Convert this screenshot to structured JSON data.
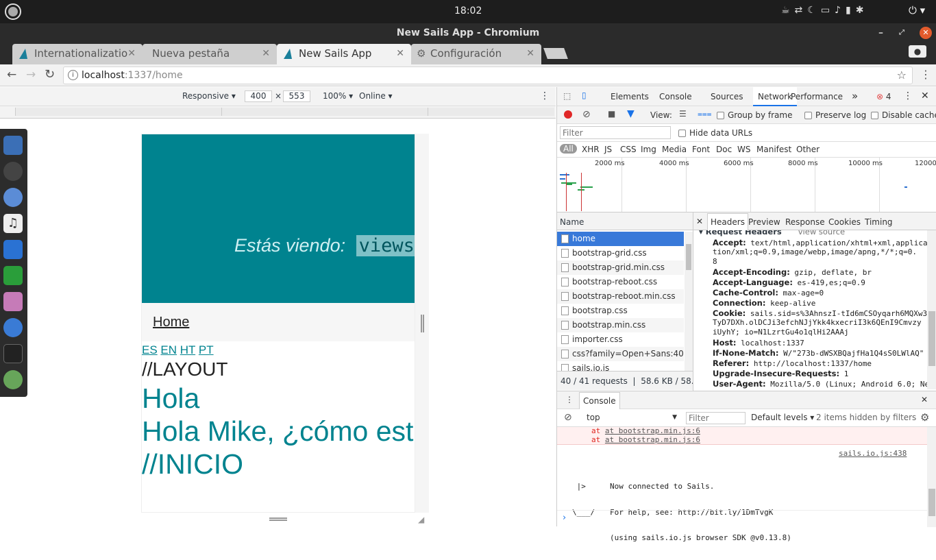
{
  "os": {
    "time": "18:02"
  },
  "window": {
    "title": "New Sails App - Chromium"
  },
  "tabs": [
    {
      "label": "Internationalizatio"
    },
    {
      "label": "Nueva pestaña"
    },
    {
      "label": "New Sails App"
    },
    {
      "label": "Configuración"
    }
  ],
  "address": {
    "host": "localhost",
    "rest": ":1337/home"
  },
  "device_toolbar": {
    "mode": "Responsive",
    "width": "400",
    "height": "553",
    "zoom": "100%",
    "network": "Online"
  },
  "page": {
    "hero_text": "Estás viendo:",
    "hero_code": "views/",
    "nav_home": "Home",
    "langs": [
      "ES",
      "EN",
      "HT",
      "PT"
    ],
    "layout": "//LAYOUT",
    "hola": "Hola",
    "greeting": "Hola Mike, ¿cómo estás?",
    "inicio": "//INICIO"
  },
  "devtools": {
    "tabs": [
      "Elements",
      "Console",
      "Sources",
      "Network",
      "Performance"
    ],
    "error_count": "4",
    "view_label": "View:",
    "group_by_frame": "Group by frame",
    "preserve_log": "Preserve log",
    "disable_cache": "Disable cache",
    "filter_placeholder": "Filter",
    "hide_data_urls": "Hide data URLs",
    "types": [
      "All",
      "XHR",
      "JS",
      "CSS",
      "Img",
      "Media",
      "Font",
      "Doc",
      "WS",
      "Manifest",
      "Other"
    ],
    "timeline_ticks": [
      "2000 ms",
      "4000 ms",
      "6000 ms",
      "8000 ms",
      "10000 ms",
      "12000"
    ],
    "name_header": "Name",
    "files": [
      "home",
      "bootstrap-grid.css",
      "bootstrap-grid.min.css",
      "bootstrap-reboot.css",
      "bootstrap-reboot.min.css",
      "bootstrap.css",
      "bootstrap.min.css",
      "importer.css",
      "css?family=Open+Sans:400it...",
      "sails.io.js"
    ],
    "summary": "40 / 41 requests  |  58.6 KB / 58....",
    "detail_tabs": [
      "Headers",
      "Preview",
      "Response",
      "Cookies",
      "Timing"
    ],
    "req_headers_title": "Request Headers",
    "view_source": "view source",
    "headers": [
      {
        "k": "Accept:",
        "v": "text/html,application/xhtml+xml,applica"
      },
      {
        "k": "",
        "v": "tion/xml;q=0.9,image/webp,image/apng,*/*;q=0."
      },
      {
        "k": "",
        "v": "8"
      },
      {
        "k": "Accept-Encoding:",
        "v": "gzip, deflate, br"
      },
      {
        "k": "Accept-Language:",
        "v": "es-419,es;q=0.9"
      },
      {
        "k": "Cache-Control:",
        "v": "max-age=0"
      },
      {
        "k": "Connection:",
        "v": "keep-alive"
      },
      {
        "k": "Cookie:",
        "v": "sails.sid=s%3AhnszI-tId6mCSOyqarh6MQXw3"
      },
      {
        "k": "",
        "v": "TyD7DXh.olDCJi3efchNJjYkk4kxecriI3k6QEnI9Cmvzy"
      },
      {
        "k": "",
        "v": "iUyhY; io=N1LzrtGu4o1qlHi2AAAj"
      },
      {
        "k": "Host:",
        "v": "localhost:1337"
      },
      {
        "k": "If-None-Match:",
        "v": "W/\"273b-dWSXBQajfHa1Q4sS0LWlAQ\""
      },
      {
        "k": "Referer:",
        "v": "http://localhost:1337/home"
      },
      {
        "k": "Upgrade-Insecure-Requests:",
        "v": "1"
      },
      {
        "k": "User-Agent:",
        "v": "Mozilla/5.0 (Linux; Android 6.0; Ne"
      }
    ],
    "console": {
      "title": "Console",
      "context": "top",
      "filter_placeholder": "Filter",
      "levels": "Default levels",
      "hidden": "2 items hidden by filters",
      "err_lines": [
        "at bootstrap.min.js:6",
        "at bootstrap.min.js:6"
      ],
      "source_link": "sails.io.js:438",
      "sails_logo": [
        " |>",
        "\\___/"
      ],
      "msg_lines": [
        "Now connected to Sails.",
        "For help, see: http://bit.ly/1DmTvgK",
        "(using sails.io.js browser SDK @v0.13.8)"
      ]
    }
  },
  "colors": {
    "teal": "#00838f",
    "link": "#00838f",
    "selected_row": "#3879d9",
    "error_bg": "#fff0f0"
  }
}
